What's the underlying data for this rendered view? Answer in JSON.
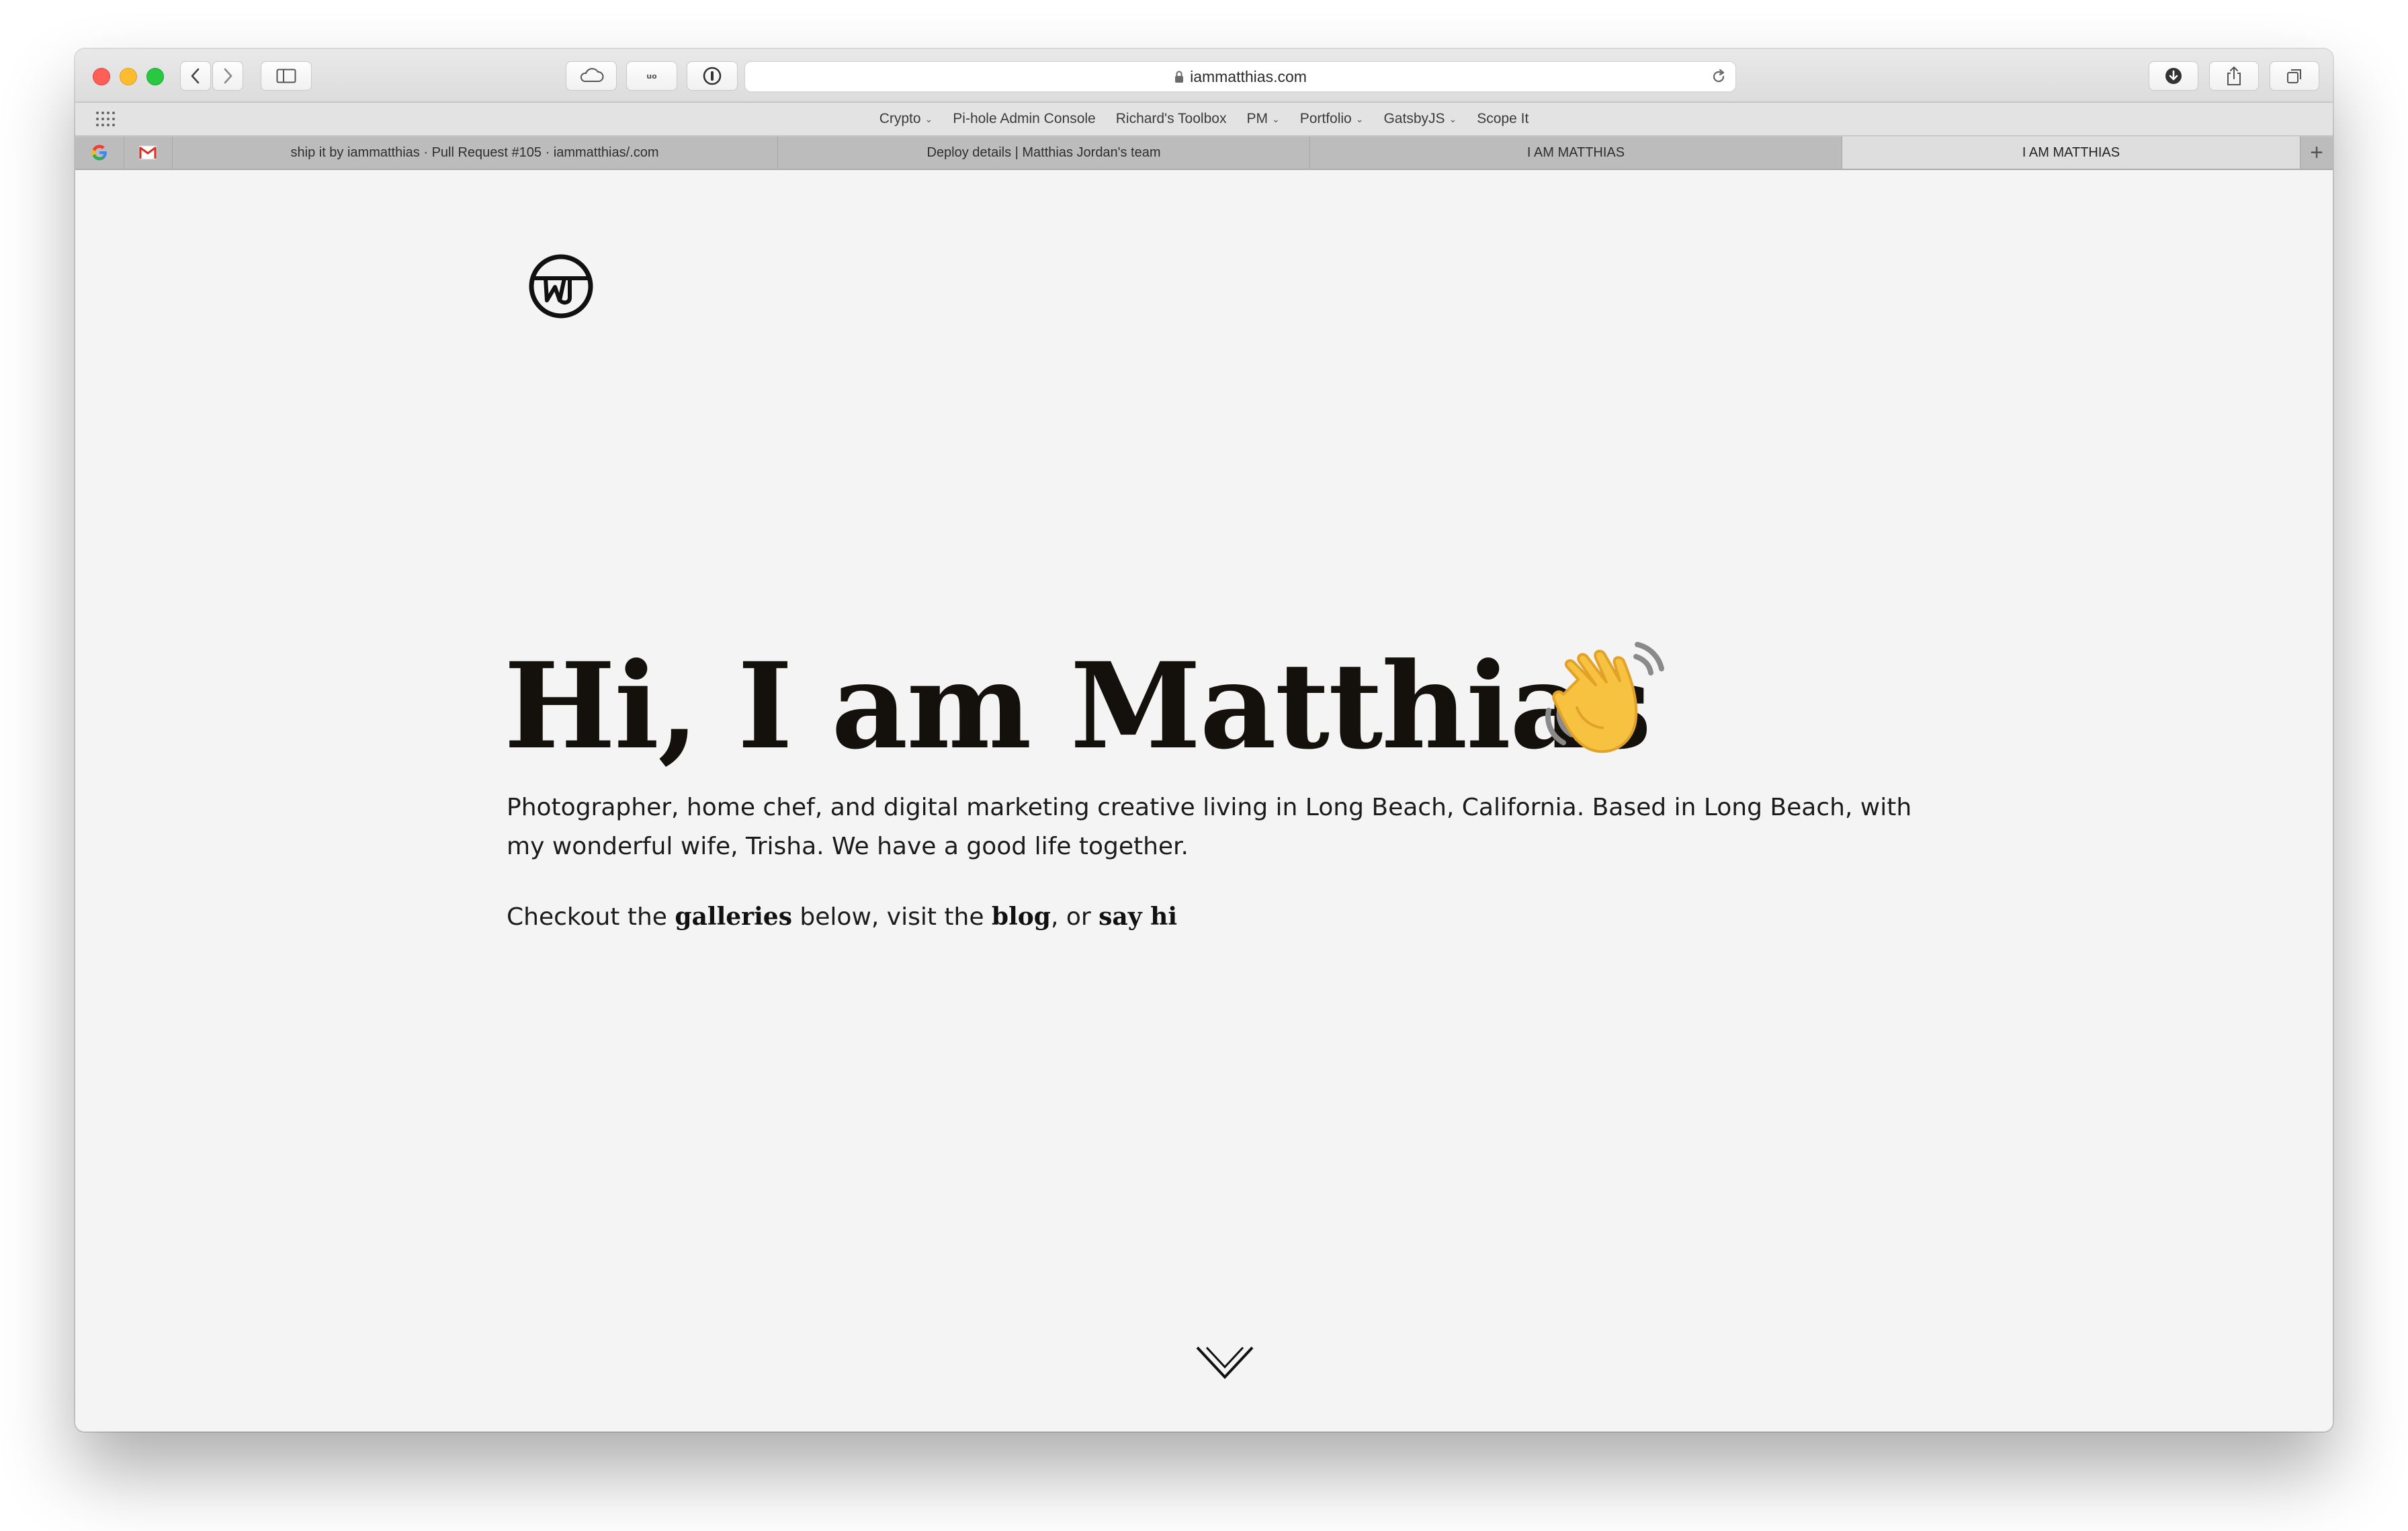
{
  "browser": {
    "url": "iammatthias.com",
    "favorites": [
      {
        "label": "Crypto",
        "has_menu": true
      },
      {
        "label": "Pi-hole Admin Console",
        "has_menu": false
      },
      {
        "label": "Richard's Toolbox",
        "has_menu": false
      },
      {
        "label": "PM",
        "has_menu": true
      },
      {
        "label": "Portfolio",
        "has_menu": true
      },
      {
        "label": "GatsbyJS",
        "has_menu": true
      },
      {
        "label": "Scope It",
        "has_menu": false
      }
    ],
    "tabs": [
      {
        "title": "ship it by iammatthias · Pull Request #105 · iammatthias/.com",
        "active": false
      },
      {
        "title": "Deploy details | Matthias Jordan's team",
        "active": false
      },
      {
        "title": "I AM MATTHIAS",
        "active": false
      },
      {
        "title": "I AM MATTHIAS",
        "active": true
      }
    ],
    "new_tab_label": "+",
    "colors": {
      "close": "#fe5f57",
      "minimize": "#febc2e",
      "zoom": "#28c840"
    }
  },
  "page": {
    "logo_icon": "mj-monogram-icon",
    "title": "Hi, I am Matthias",
    "title_emoji_icon": "waving-hand-icon",
    "intro": "Photographer, home chef, and digital marketing creative living in Long Beach, California. Based in Long Beach, with my wonderful wife, Trisha. We have a good life together.",
    "cta": {
      "prefix": "Checkout the ",
      "galleries": "galleries",
      "middle": " below, visit the ",
      "blog": "blog",
      "connector": ", or ",
      "say_hi": "say hi"
    },
    "scroll_icon": "chevron-down-icon",
    "text_color": "#14110c",
    "background": "#f4f4f4"
  }
}
